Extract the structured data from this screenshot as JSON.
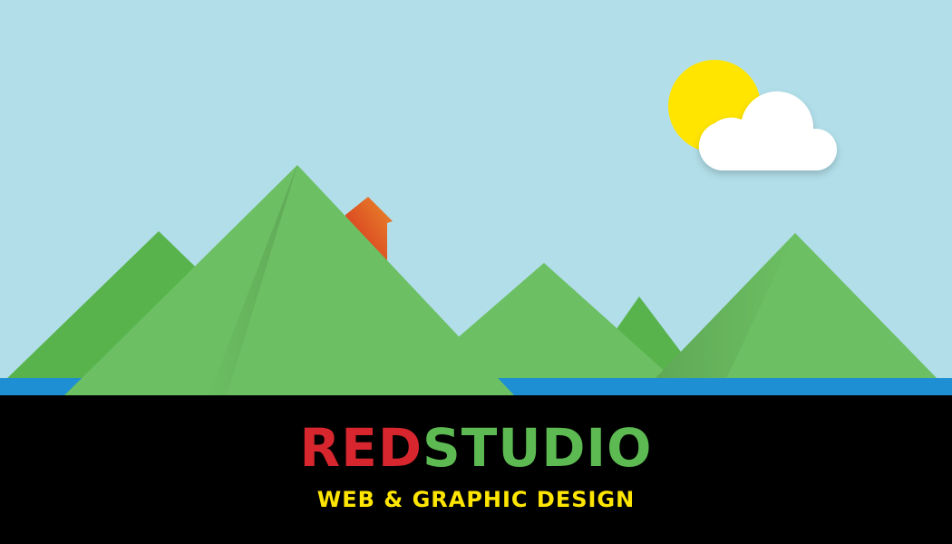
{
  "brand": {
    "part1": "RED",
    "part2": "STUDIO",
    "tagline": "WEB & GRAPHIC DESIGN"
  },
  "colors": {
    "sky": "#b1dee9",
    "sun": "#ffe500",
    "cloud": "#ffffff",
    "mountain": "#6cbf62",
    "mountain_dark": "#58b34c",
    "water": "#1e8fd2",
    "footer_background": "#000000",
    "brand_red": "#d7262e",
    "brand_green": "#5dba52",
    "tagline": "#ffe600",
    "house_red": "#d42a1f",
    "house_orange": "#ea8a2b"
  },
  "scene": {
    "sun_icon": "sun-icon",
    "cloud_icon": "cloud-icon",
    "house_icon": "house-icon"
  }
}
